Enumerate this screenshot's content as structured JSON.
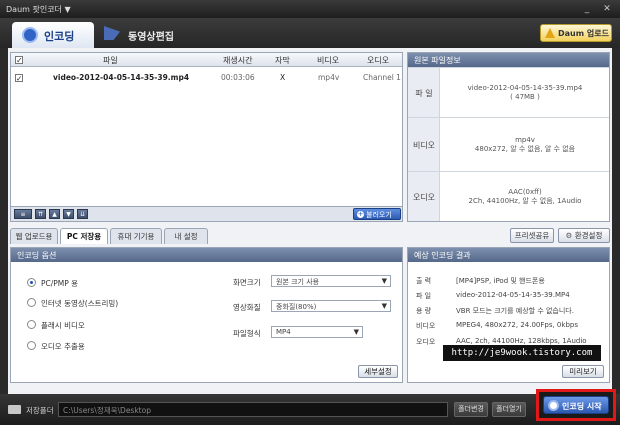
{
  "window": {
    "title": "Daum 팟인코더 ▼",
    "minimize": "_",
    "close": "✕"
  },
  "tabs": {
    "encoding": "인코딩",
    "video_edit": "동영상편집"
  },
  "header_button": "Daum 업로드",
  "file_list": {
    "columns": [
      "파일",
      "재생시간",
      "자막",
      "비디오",
      "오디오"
    ],
    "rows": [
      {
        "checked": true,
        "file": "video-2012-04-05-14-35-39.mp4",
        "duration": "00:03:06",
        "subtitle": "X",
        "video": "mp4v",
        "audio": "Channel 1"
      }
    ],
    "add_button": "불러오기"
  },
  "source_info": {
    "title": "원본 파일정보",
    "rows": [
      {
        "label": "파 일",
        "value": [
          "video-2012-04-05-14-35-39.mp4",
          "( 47MB )"
        ]
      },
      {
        "label": "비디오",
        "value": [
          "mp4v",
          "480x272, 알 수 없음, 알 수 없음"
        ]
      },
      {
        "label": "오디오",
        "value": [
          "AAC(0xff)",
          "2Ch, 44100Hz, 알 수 없음, 1Audio"
        ]
      }
    ]
  },
  "option_tabs": [
    "웹 업로드용",
    "PC 저장용",
    "휴대 기기용",
    "내 설정"
  ],
  "option_tabs_active": 1,
  "right_buttons": {
    "preset_share": "프리셋공유",
    "settings": "환경설정"
  },
  "encoding_options": {
    "title": "인코딩 옵션",
    "radios": [
      {
        "label": "PC/PMP 용",
        "selected": true
      },
      {
        "label": "인터넷 동영상(스트리밍)",
        "selected": false
      },
      {
        "label": "플래시 비디오",
        "selected": false
      },
      {
        "label": "오디오 추출용",
        "selected": false
      }
    ],
    "fields": [
      {
        "label": "화면크기",
        "value": "원본 크기 사용"
      },
      {
        "label": "영상화질",
        "value": "중화질(80%)"
      },
      {
        "label": "파일형식",
        "value": "MP4"
      }
    ],
    "detail_button": "세부설정"
  },
  "expected_result": {
    "title": "예상 인코딩 결과",
    "rows": [
      {
        "label": "출 력",
        "value": "[MP4]PSP, iPod 및 핸드폰용"
      },
      {
        "label": "파 일",
        "value": "video-2012-04-05-14-35-39.MP4"
      },
      {
        "label": "용 량",
        "value": "VBR 모드는 크기를 예상할 수 없습니다."
      },
      {
        "label": "비디오",
        "value": "MPEG4, 480x272, 24.00Fps, 0kbps"
      },
      {
        "label": "오디오",
        "value": "AAC, 2ch, 44100Hz, 128kbps, 1Audio"
      }
    ],
    "preview_button": "미리보기"
  },
  "watermark": "http://je9wook.tistory.com",
  "bottom": {
    "save_folder_label": "저장폴더",
    "path": "C:\\Users\\정재욱\\Desktop",
    "change_folder": "폴더변경",
    "open_folder": "폴더열기",
    "start_button": "인코딩 시작"
  }
}
